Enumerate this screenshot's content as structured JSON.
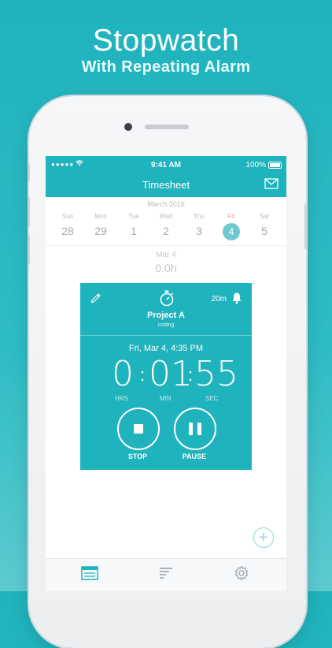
{
  "headline": {
    "title": "Stopwatch",
    "subtitle": "With Repeating Alarm"
  },
  "status_bar": {
    "signal": "●●●●●",
    "time": "9:41 AM",
    "battery": "100%"
  },
  "nav": {
    "title": "Timesheet"
  },
  "calendar": {
    "month": "March 2016",
    "days": [
      {
        "name": "Sun",
        "date": "28"
      },
      {
        "name": "Mon",
        "date": "29"
      },
      {
        "name": "Tue",
        "date": "1"
      },
      {
        "name": "Wed",
        "date": "2"
      },
      {
        "name": "Thu",
        "date": "3"
      },
      {
        "name": "Fri",
        "date": "4"
      },
      {
        "name": "Sat",
        "date": "5"
      }
    ],
    "selected": "4"
  },
  "day_summary": {
    "date": "Mar 4",
    "hours": "0.0h"
  },
  "timer_card": {
    "project": "Project A",
    "task": "coding",
    "alarm_interval": "20m",
    "started": "Fri, Mar 4, 4:35 PM",
    "hrs": "0",
    "min": "01",
    "sec": "55",
    "hrs_label": "HRS",
    "min_label": "MIN",
    "sec_label": "SEC",
    "stop_label": "STOP",
    "pause_label": "PAUSE"
  },
  "fab": {
    "label": "+"
  },
  "tabs": [
    "timesheet-icon",
    "reports-icon",
    "settings-icon"
  ],
  "colors": {
    "accent": "#1fb3bd",
    "background": "#2fbcc4"
  }
}
